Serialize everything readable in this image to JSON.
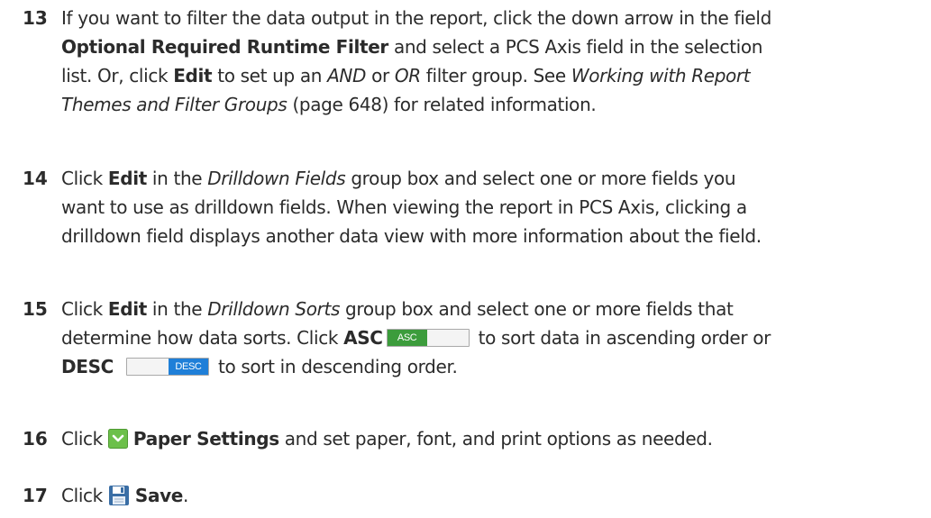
{
  "steps": [
    {
      "number": "13",
      "lines": [
        {
          "a": "If you want to filter the data output in the report, click the down arrow in the field"
        },
        {
          "b": "Optional Required Runtime Filter",
          "c": " and select a PCS Axis field in the selection"
        },
        {
          "a": "list. Or, click ",
          "b": "Edit",
          "c": " to set up an ",
          "d": "AND",
          "e": " or ",
          "f": "OR",
          "g": " filter group. See ",
          "h": "Working with Report"
        },
        {
          "a": "Themes and Filter Groups",
          "b": " (page 648) for related information."
        }
      ]
    },
    {
      "number": "14",
      "lines": [
        {
          "a": "Click ",
          "b": "Edit",
          "c": " in the ",
          "d": "Drilldown Fields",
          "e": " group box and select one or more fields you"
        },
        {
          "a": "want to use as drilldown fields. When viewing the report in PCS Axis, clicking a"
        },
        {
          "a": "drilldown field displays another data view with more information about the field."
        }
      ]
    },
    {
      "number": "15",
      "lines": [
        {
          "a": "Click ",
          "b": "Edit",
          "c": " in the ",
          "d": "Drilldown Sorts",
          "e": " group box and select one or more fields that"
        },
        {
          "a": "determine how data sorts. Click ",
          "b": "ASC",
          "c": " to sort data in ascending order or"
        },
        {
          "a": "DESC",
          "b": " to sort in descending order."
        }
      ]
    },
    {
      "number": "16",
      "lines": [
        {
          "a": "Click ",
          "b": "Paper Settings",
          "c": " and set paper, font, and print options as needed."
        }
      ]
    },
    {
      "number": "17",
      "lines": [
        {
          "a": "Click ",
          "b": "Save",
          "c": "."
        }
      ]
    }
  ],
  "toggles": {
    "asc_label": "ASC",
    "desc_label": "DESC"
  },
  "icons": {
    "paper_settings": "chevron-down-icon",
    "save": "floppy-disk-icon"
  },
  "colors": {
    "text": "#2b2b2b",
    "asc_green": "#3c9c3c",
    "desc_blue": "#1f7fd8",
    "paper_icon_green": "#6cc04a",
    "save_icon_blue": "#3a6ea5"
  }
}
